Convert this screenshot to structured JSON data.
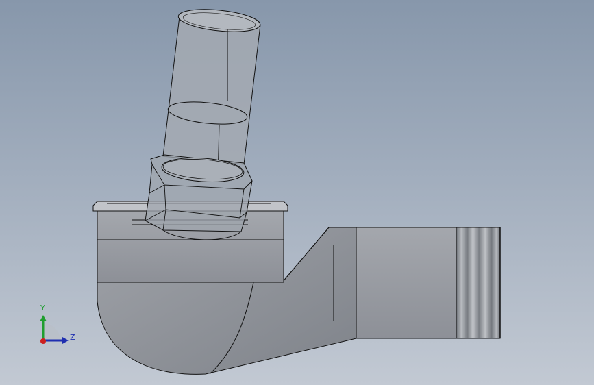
{
  "triad": {
    "y_label": "Y",
    "z_label": "Z",
    "y_color": "#1f9e2f",
    "z_color": "#1f2fb0",
    "origin_color": "#cc1f1f"
  },
  "colors": {
    "background_top": "#8797ab",
    "background_bottom": "#c2c9d3",
    "body_fill": "#9a9da3",
    "glass_fill": "#a3a9b2",
    "edge": "#111111"
  }
}
